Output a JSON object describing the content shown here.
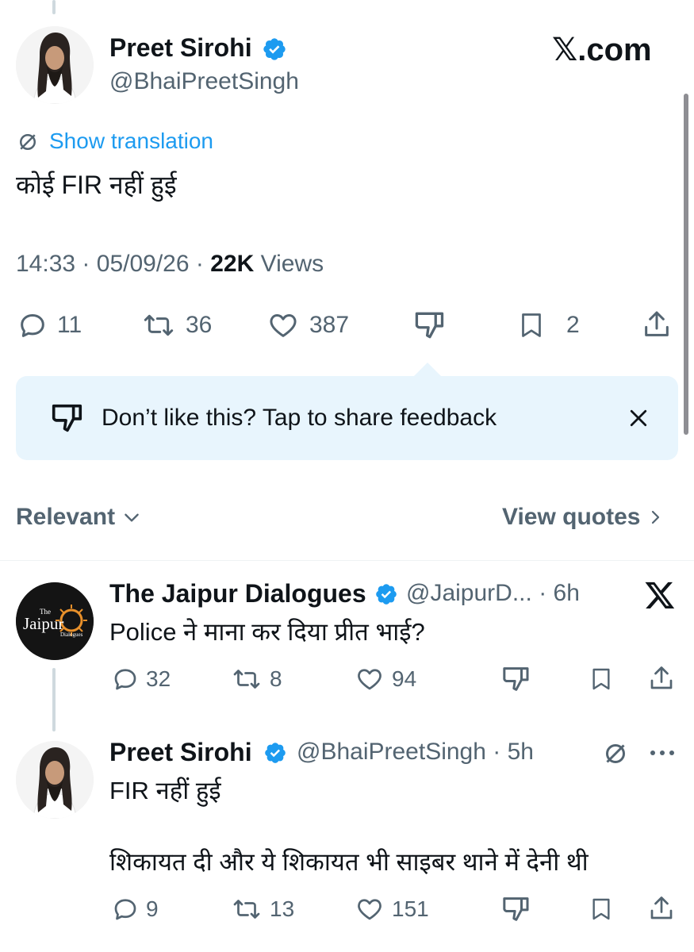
{
  "brand": {
    "site_label": "𝕏.com"
  },
  "main_post": {
    "author_name": "Preet Sirohi",
    "handle": "@BhaiPreetSingh",
    "show_translation": "Show translation",
    "text": "कोई FIR नहीं हुई",
    "time": "14:33",
    "date": "05/09/26",
    "sep": "·",
    "views_count": "22K",
    "views_label": "Views",
    "replies": "11",
    "reposts": "36",
    "likes": "387",
    "bookmarks": "2"
  },
  "feedback": {
    "text": "Don’t like this? Tap to share feedback"
  },
  "sort": {
    "relevant_label": "Relevant",
    "view_quotes_label": "View quotes"
  },
  "replies": [
    {
      "author_name": "The Jaipur Dialogues",
      "handle": "@JaipurD...",
      "time": "· 6h",
      "text": "Police ने माना कर दिया प्रीत भाई?",
      "replies": "32",
      "reposts": "8",
      "likes": "94",
      "avatar_text": "Jaipur",
      "avatar_top": "The",
      "avatar_bottom": "Dialogues"
    },
    {
      "author_name": "Preet Sirohi",
      "handle": "@BhaiPreetSingh",
      "time": "· 5h",
      "text_line1": "FIR नहीं हुई",
      "text_line2": "शिकायत दी और ये शिकायत भी साइबर थाने में देनी थी",
      "replies": "9",
      "reposts": "13",
      "likes": "151"
    }
  ],
  "icons": [
    "verified-badge",
    "translate-icon",
    "reply-icon",
    "repost-icon",
    "like-icon",
    "dislike-icon",
    "bookmark-icon",
    "share-icon",
    "close-icon",
    "chevron-down-icon",
    "chevron-right-icon",
    "x-logo",
    "more-icon"
  ],
  "colors": {
    "accent": "#1d9bf0",
    "muted": "#536471",
    "feedback_bg": "#e8f5fd",
    "divider": "#eff3f4"
  }
}
